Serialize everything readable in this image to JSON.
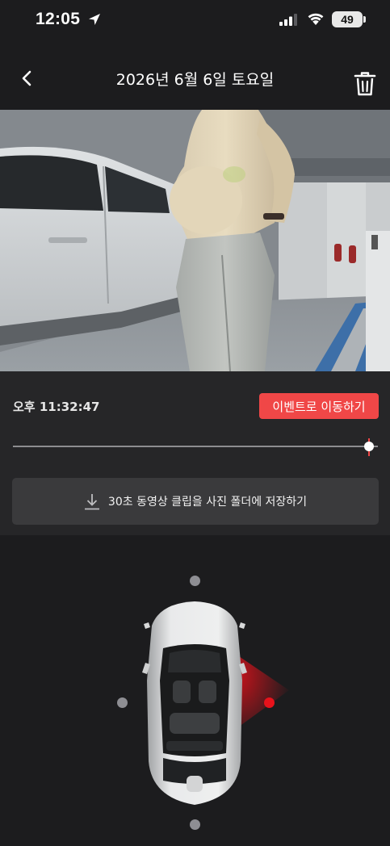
{
  "status_bar": {
    "time": "12:05",
    "battery": "49",
    "icons": [
      "location-arrow-icon",
      "signal-icon",
      "wifi-icon",
      "battery-icon"
    ]
  },
  "header": {
    "title": "2026년 6월 6일 토요일",
    "back_icon": "chevron-left-icon",
    "delete_icon": "trash-icon"
  },
  "controls": {
    "timestamp": "오후 11:32:47",
    "event_button_label": "이벤트로 이동하기",
    "slider_position_fraction": 0.97,
    "save_button_label": "30초 동영상 클립을 사진 폴더에 저장하기",
    "save_icon": "download-icon"
  },
  "camera_selector": {
    "active_camera": "right-rear",
    "colors": {
      "active": "#e8121b",
      "inactive": "#8e8e93",
      "accent": "#f04747"
    }
  }
}
